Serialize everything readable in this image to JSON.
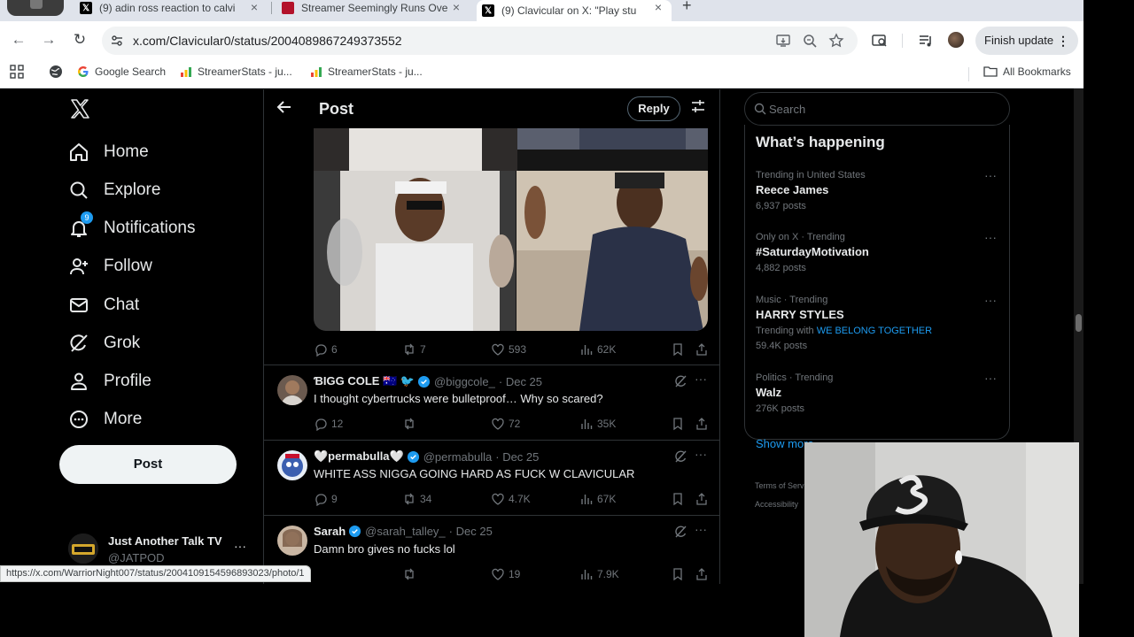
{
  "browser": {
    "tabs": [
      {
        "title": "(9) adin ross reaction to calvi"
      },
      {
        "title": "Streamer Seemingly Runs Ove"
      },
      {
        "title": "(9) Clavicular on X: \"Play stu"
      }
    ],
    "url": "x.com/Clavicular0/status/2004089867249373552",
    "finish_update": "Finish update",
    "bookmarks": [
      "Google Search",
      "StreamerStats - ju...",
      "StreamerStats - ju..."
    ],
    "all_bookmarks": "All Bookmarks",
    "status_url": "https://x.com/WarriorNight007/status/2004109154596893023/photo/1"
  },
  "sidebar": {
    "items": [
      {
        "label": "Home",
        "icon": "home-icon"
      },
      {
        "label": "Explore",
        "icon": "search-icon"
      },
      {
        "label": "Notifications",
        "icon": "bell-icon",
        "badge": "9"
      },
      {
        "label": "Follow",
        "icon": "person-plus-icon"
      },
      {
        "label": "Chat",
        "icon": "envelope-icon"
      },
      {
        "label": "Grok",
        "icon": "grok-icon"
      },
      {
        "label": "Profile",
        "icon": "person-icon"
      },
      {
        "label": "More",
        "icon": "more-circle-icon"
      }
    ],
    "post_label": "Post",
    "account": {
      "name": "Just Another Talk TV",
      "handle": "@JATPOD"
    }
  },
  "main": {
    "title": "Post",
    "reply_button": "Reply",
    "post_stats": {
      "replies": "6",
      "reposts": "7",
      "likes": "593",
      "views": "62K"
    },
    "replies": [
      {
        "name": "ƁIGG COLE 🇦🇺 🐦",
        "handle": "@biggcole_",
        "date": "· Dec 25",
        "text": "I thought cybertrucks were bulletproof… Why so scared?",
        "stats": {
          "replies": "12",
          "reposts": "",
          "likes": "72",
          "views": "35K"
        }
      },
      {
        "name": "🤍permabulla🤍",
        "handle": "@permabulla",
        "date": "· Dec 25",
        "text": "WHITE ASS NIGGA GOING HARD AS FUCK W CLAVICULAR",
        "stats": {
          "replies": "9",
          "reposts": "34",
          "likes": "4.7K",
          "views": "67K"
        }
      },
      {
        "name": "Sarah",
        "handle": "@sarah_talley_",
        "date": "· Dec 25",
        "text": "Damn bro gives no fucks lol",
        "stats": {
          "replies": "",
          "reposts": "",
          "likes": "19",
          "views": "7.9K"
        }
      }
    ]
  },
  "right": {
    "search_placeholder": "Search",
    "whats_happening": "What’s happening",
    "trends": [
      {
        "meta": "Trending in United States",
        "name": "Reece James",
        "posts": "6,937 posts"
      },
      {
        "meta": "Only on X · Trending",
        "name": "#SaturdayMotivation",
        "posts": "4,882 posts"
      },
      {
        "meta": "Music · Trending",
        "name": "HARRY STYLES",
        "with_label": "Trending with",
        "with_link": "WE BELONG TOGETHER",
        "posts": "59.4K posts"
      },
      {
        "meta": "Politics · Trending",
        "name": "Walz",
        "posts": "276K posts"
      }
    ],
    "show_more": "Show more",
    "footer_terms": "Terms of Serv",
    "footer_access": "Accessibility"
  },
  "colors": {
    "accent": "#1d9bf0",
    "x_bg": "#000000",
    "text": "#e7e9ea",
    "muted": "#71767b"
  }
}
